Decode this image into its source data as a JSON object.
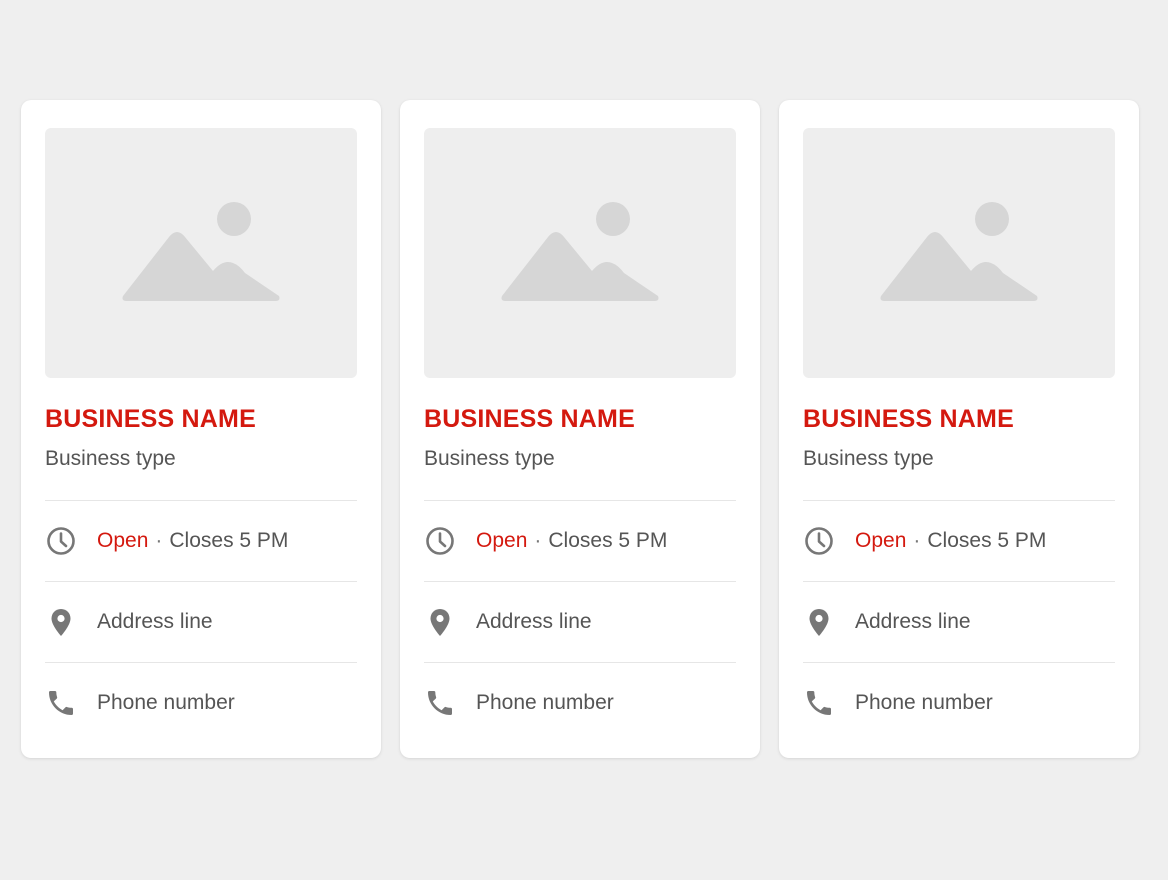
{
  "accent_color": "#d4190f",
  "cards": [
    {
      "name": "BUSINESS NAME",
      "type": "Business type",
      "status_open": "Open",
      "separator": "·",
      "closes": "Closes 5 PM",
      "address": "Address line",
      "phone": "Phone number",
      "image_icon": "image-placeholder-icon",
      "hours_icon": "clock-icon",
      "address_icon": "location-pin-icon",
      "phone_icon": "phone-icon"
    },
    {
      "name": "BUSINESS NAME",
      "type": "Business type",
      "status_open": "Open",
      "separator": "·",
      "closes": "Closes 5 PM",
      "address": "Address line",
      "phone": "Phone number",
      "image_icon": "image-placeholder-icon",
      "hours_icon": "clock-icon",
      "address_icon": "location-pin-icon",
      "phone_icon": "phone-icon"
    },
    {
      "name": "BUSINESS NAME",
      "type": "Business type",
      "status_open": "Open",
      "separator": "·",
      "closes": "Closes 5 PM",
      "address": "Address line",
      "phone": "Phone number",
      "image_icon": "image-placeholder-icon",
      "hours_icon": "clock-icon",
      "address_icon": "location-pin-icon",
      "phone_icon": "phone-icon"
    }
  ]
}
